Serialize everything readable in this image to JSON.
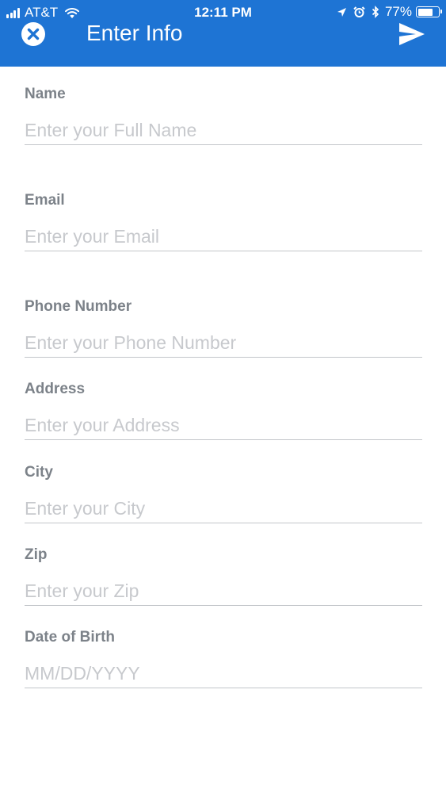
{
  "status_bar": {
    "carrier": "AT&T",
    "time": "12:11 PM",
    "battery_percent": "77%",
    "battery_level": 0.77,
    "icons": [
      "signal-icon",
      "wifi-icon",
      "location-icon",
      "alarm-icon",
      "bluetooth-icon",
      "battery-icon"
    ]
  },
  "header": {
    "title": "Enter Info",
    "close_icon": "close-circle-icon",
    "send_icon": "send-icon",
    "background": "#1e74d4"
  },
  "form": {
    "fields": [
      {
        "label": "Name",
        "placeholder": "Enter your Full Name",
        "value": ""
      },
      {
        "label": "Email",
        "placeholder": "Enter your Email",
        "value": ""
      },
      {
        "label": "Phone Number",
        "placeholder": "Enter your Phone Number",
        "value": ""
      },
      {
        "label": "Address",
        "placeholder": "Enter your Address",
        "value": ""
      },
      {
        "label": "City",
        "placeholder": "Enter your City",
        "value": ""
      },
      {
        "label": "Zip",
        "placeholder": "Enter your Zip",
        "value": ""
      },
      {
        "label": "Date of Birth",
        "placeholder": "MM/DD/YYYY",
        "value": ""
      }
    ]
  }
}
